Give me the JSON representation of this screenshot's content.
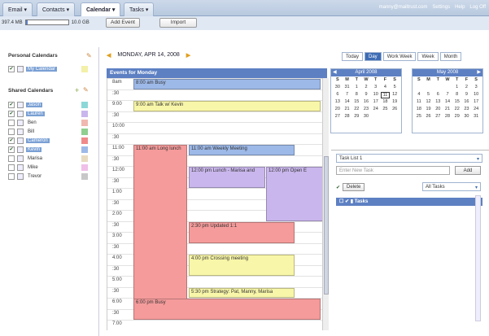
{
  "tabs": [
    "Email ▾",
    "Contacts ▾",
    "Calendar ▾",
    "Tasks ▾"
  ],
  "user": {
    "email": "manny@mailtrust.com",
    "links": [
      "Settings",
      "Help",
      "Log Off"
    ]
  },
  "storage": {
    "used": "397.4 MB",
    "total": "10.0 GB",
    "fraction": 0.04
  },
  "toolbar": {
    "add_event": "Add Event",
    "import": "Import"
  },
  "sidebar": {
    "personal_title": "Personal Calendars",
    "personal": [
      {
        "name": "My Calendar",
        "checked": true,
        "selected": true,
        "color": "#f3f0a8"
      }
    ],
    "shared_title": "Shared Calendars",
    "shared": [
      {
        "name": "Jason",
        "checked": true,
        "selected": true,
        "color": "#8cd8d8"
      },
      {
        "name": "Lauren",
        "checked": true,
        "selected": true,
        "color": "#c9b6ec"
      },
      {
        "name": "Ben",
        "checked": false,
        "selected": false,
        "color": "#f0b8b0"
      },
      {
        "name": "Bill",
        "checked": false,
        "selected": false,
        "color": "#8fcf8f"
      },
      {
        "name": "Cameron",
        "checked": true,
        "selected": true,
        "color": "#f08a8a"
      },
      {
        "name": "Kevin",
        "checked": true,
        "selected": true,
        "color": "#9db9e8"
      },
      {
        "name": "Marisa",
        "checked": false,
        "selected": false,
        "color": "#e8dcc0"
      },
      {
        "name": "Mike",
        "checked": false,
        "selected": false,
        "color": "#f0c0e8"
      },
      {
        "name": "Trevor",
        "checked": false,
        "selected": false,
        "color": "#c8c8c8"
      }
    ]
  },
  "day": {
    "title": "MONDAY, APR 14, 2008",
    "header": "Events for Monday"
  },
  "views": [
    "Today",
    "Day",
    "Work Week",
    "Week",
    "Month"
  ],
  "active_view": "Day",
  "times": [
    "8am",
    ":30",
    "9:00",
    ":30",
    "10:00",
    ":30",
    "11:00",
    ":30",
    "12:00",
    ":30",
    "1:00",
    ":30",
    "2:00",
    ":30",
    "3:00",
    ":30",
    "4:00",
    ":30",
    "5:00",
    ":30",
    "6:00",
    ":30",
    "7:00"
  ],
  "events": [
    {
      "label": "8:00 am Busy",
      "start": 8,
      "end": 8.5,
      "col": "full",
      "color": "#9db9e8"
    },
    {
      "label": "9:00 am Talk w/ Kevin",
      "start": 9,
      "end": 9.5,
      "col": "full",
      "color": "#f8f6a8"
    },
    {
      "label": "11:00 am Long lunch",
      "start": 11,
      "end": 18.5,
      "col": "a",
      "color": "#f59b9b"
    },
    {
      "label": "11:00 am Weekly Meeting",
      "start": 11,
      "end": 11.5,
      "col": "b",
      "color": "#9db9e8"
    },
    {
      "label": "12:00 pm Lunch - Marisa and",
      "start": 12,
      "end": 13,
      "col": "b1",
      "color": "#c9b6ec"
    },
    {
      "label": "12:00 pm Open E",
      "start": 12,
      "end": 14.5,
      "col": "b2",
      "color": "#c9b6ec"
    },
    {
      "label": "2:30 pm Updated 1:1",
      "start": 14.5,
      "end": 15.5,
      "col": "b",
      "color": "#f59b9b"
    },
    {
      "label": "4:00 pm Crossing meeting",
      "start": 16,
      "end": 17,
      "col": "b",
      "color": "#f8f6a8"
    },
    {
      "label": "5:30 pm Strategy: Pat, Manny, Marisa",
      "start": 17.5,
      "end": 18,
      "col": "b",
      "color": "#f8f6a8"
    },
    {
      "label": "6:00 pm Busy",
      "start": 18,
      "end": 19,
      "col": "full",
      "color": "#f59b9b"
    }
  ],
  "mini_april": {
    "title": "April 2008",
    "dow": [
      "S",
      "M",
      "T",
      "W",
      "T",
      "F",
      "S"
    ],
    "days": [
      "30",
      "31",
      "1",
      "2",
      "3",
      "4",
      "5",
      "6",
      "7",
      "8",
      "9",
      "10",
      "11",
      "12",
      "13",
      "14",
      "15",
      "16",
      "17",
      "18",
      "19",
      "20",
      "21",
      "22",
      "23",
      "24",
      "25",
      "26",
      "27",
      "28",
      "29",
      "30",
      "",
      "",
      ""
    ],
    "today": "11"
  },
  "mini_may": {
    "title": "May 2008",
    "dow": [
      "S",
      "M",
      "T",
      "W",
      "T",
      "F",
      "S"
    ],
    "days": [
      "",
      "",
      "",
      "",
      "1",
      "2",
      "3",
      "4",
      "5",
      "6",
      "7",
      "8",
      "9",
      "10",
      "11",
      "12",
      "13",
      "14",
      "15",
      "16",
      "17",
      "18",
      "19",
      "20",
      "21",
      "22",
      "23",
      "24",
      "25",
      "26",
      "27",
      "28",
      "29",
      "30",
      "31"
    ]
  },
  "tasks": {
    "list": "Task List 1",
    "placeholder": "Enter New Task",
    "add": "Add",
    "delete": "Delete",
    "filter": "All Tasks",
    "header": "Tasks"
  }
}
